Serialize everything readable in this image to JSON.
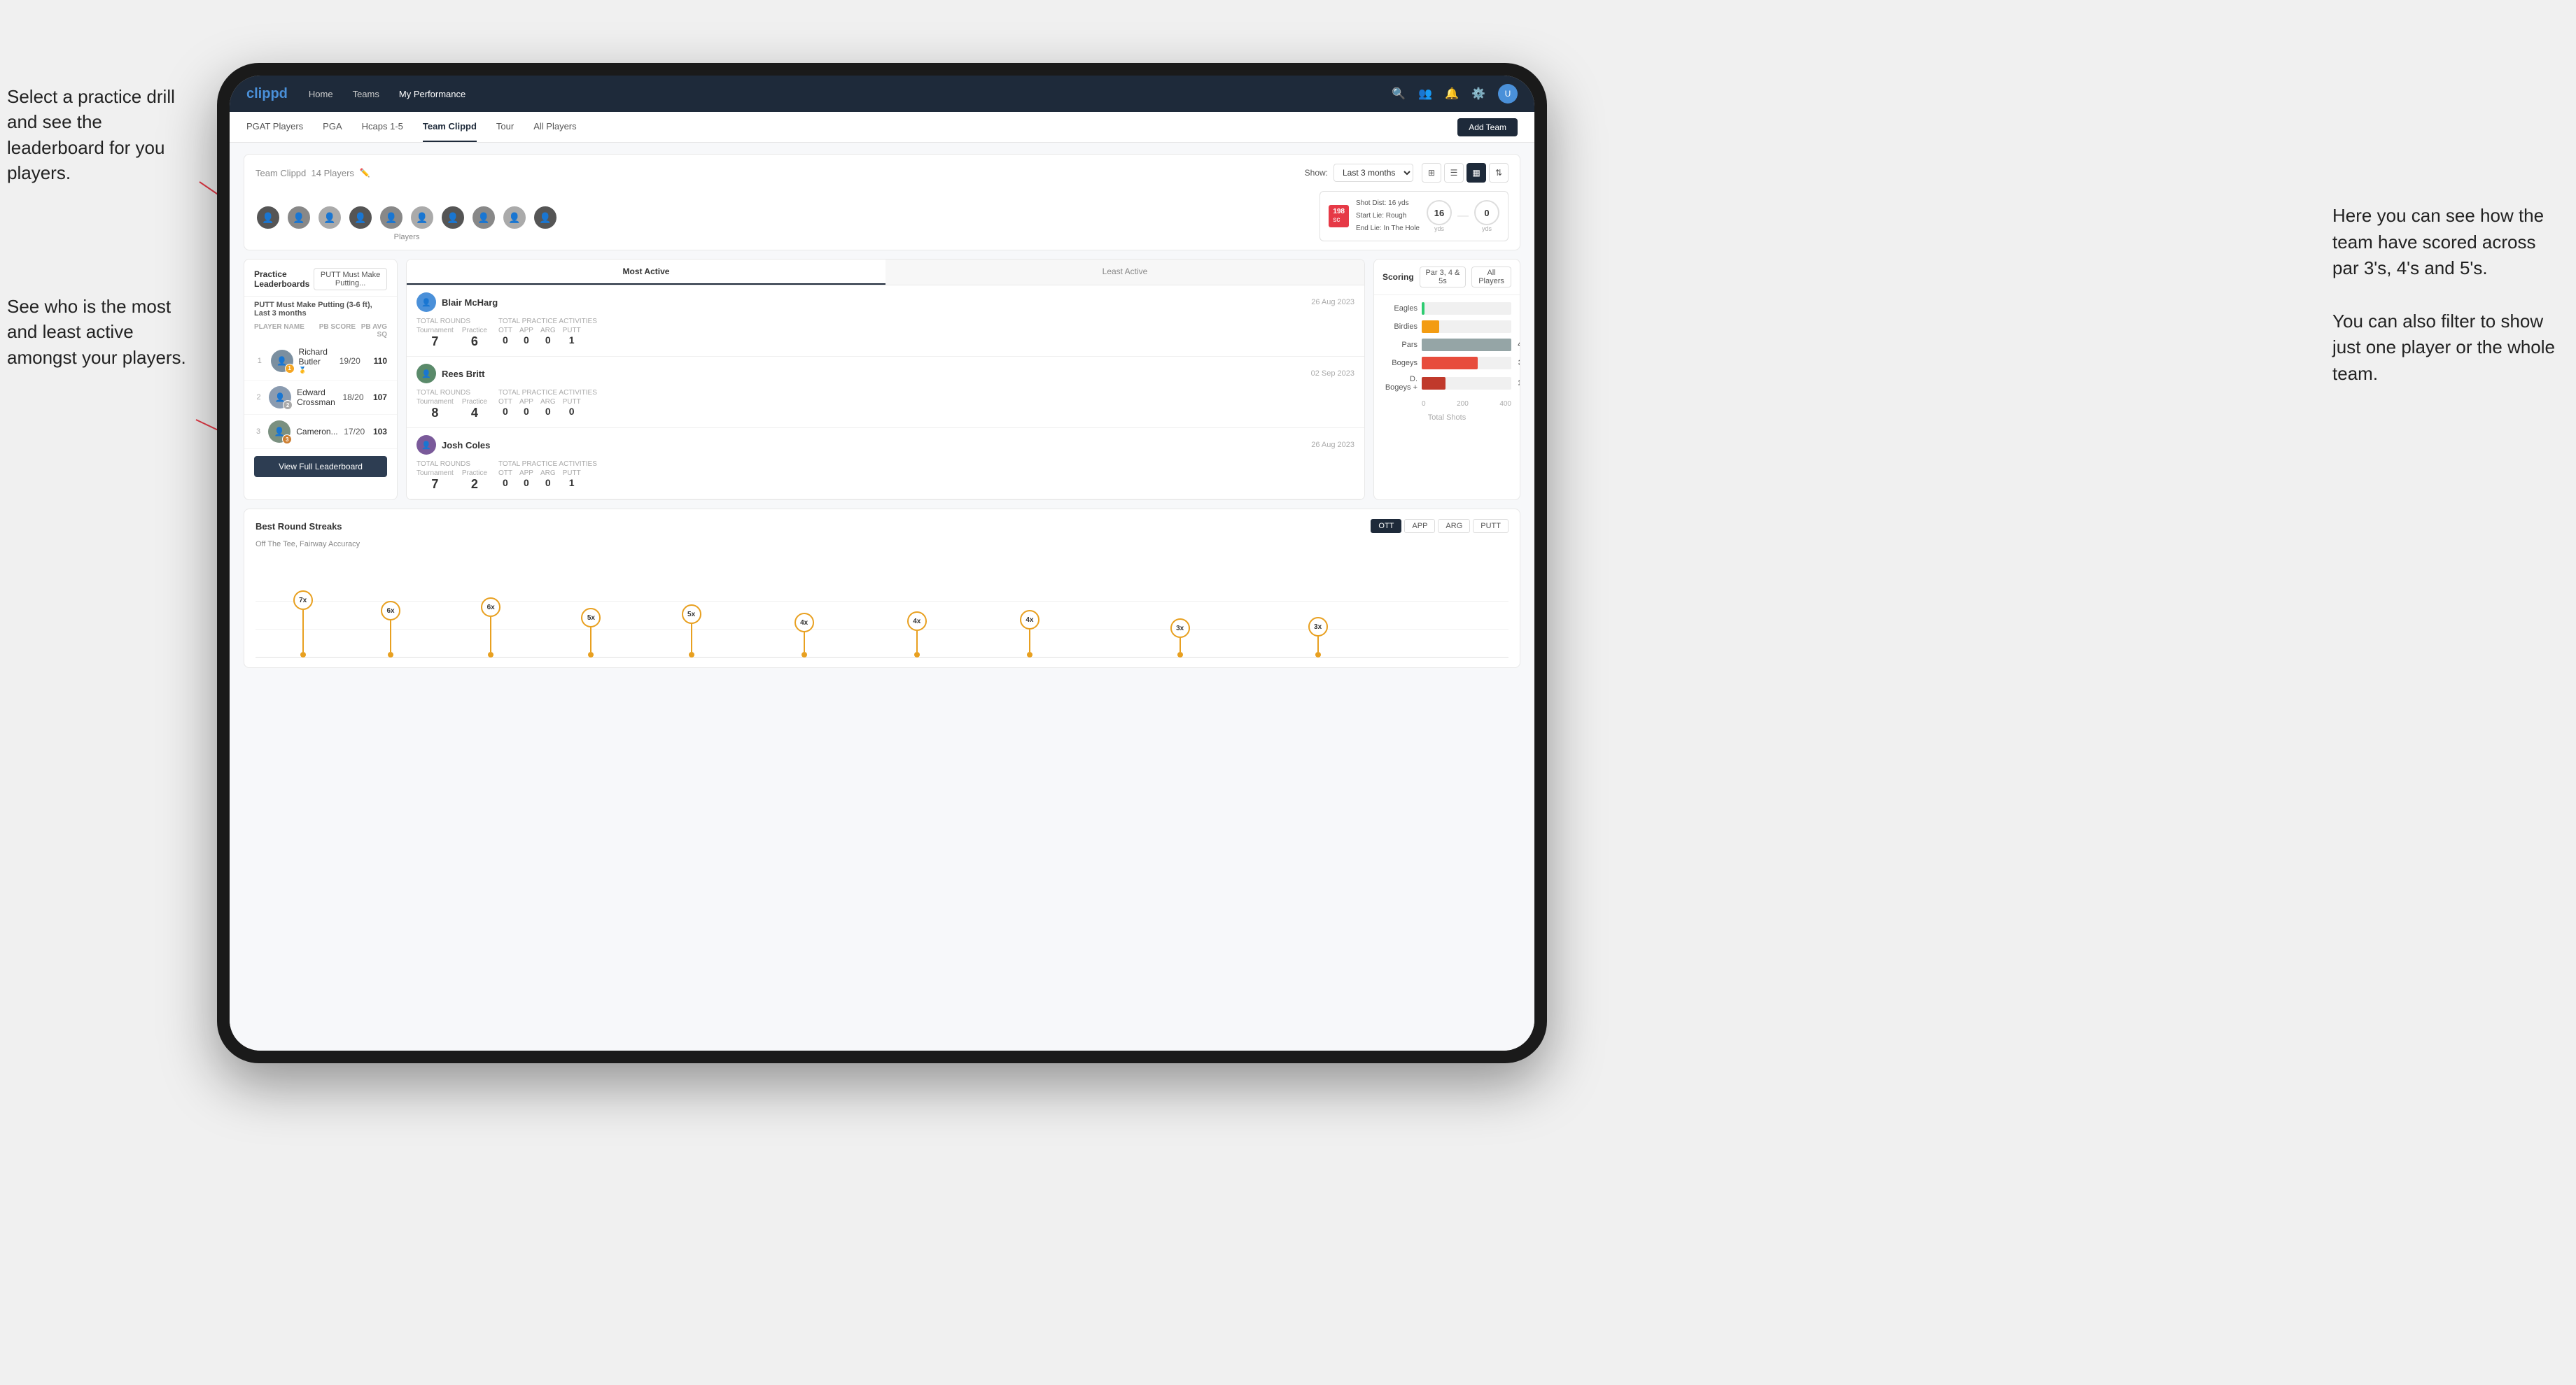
{
  "annotations": {
    "left1": "Select a practice drill and see the leaderboard for you players.",
    "left2": "See who is the most and least active amongst your players.",
    "right1_line1": "Here you can see how the",
    "right1_line2": "team have scored across",
    "right1_line3": "par 3's, 4's and 5's.",
    "right1_line4": "",
    "right1_line5": "You can also filter to show",
    "right1_line6": "just one player or the whole",
    "right1_line7": "team."
  },
  "navbar": {
    "logo": "clippd",
    "links": [
      "Home",
      "Teams",
      "My Performance"
    ],
    "icons": [
      "search",
      "people",
      "bell",
      "settings",
      "avatar"
    ]
  },
  "subnav": {
    "links": [
      "PGAT Players",
      "PGA",
      "Hcaps 1-5",
      "Team Clippd",
      "Tour",
      "All Players"
    ],
    "active": "Team Clippd",
    "add_button": "Add Team"
  },
  "team_header": {
    "title": "Team Clippd",
    "player_count": "14 Players",
    "show_label": "Show:",
    "period": "Last 3 months",
    "players_label": "Players"
  },
  "shot_info": {
    "shot_dist": "Shot Dist: 16 yds",
    "start_lie": "Start Lie: Rough",
    "end_lie": "End Lie: In The Hole",
    "value1": "198",
    "unit1": "sc",
    "yards1": "16",
    "unit_yds1": "yds",
    "yards2": "0",
    "unit_yds2": "yds"
  },
  "practice_leaderboards": {
    "title": "Practice Leaderboards",
    "dropdown": "PUTT Must Make Putting...",
    "subtitle_drill": "PUTT Must Make Putting (3-6 ft),",
    "subtitle_period": "Last 3 months",
    "col_player": "PLAYER NAME",
    "col_score": "PB SCORE",
    "col_avg": "PB AVG SQ",
    "players": [
      {
        "rank": 1,
        "name": "Richard Butler",
        "score": "19/20",
        "avg": "110",
        "badge": "gold",
        "avatar_color": "#7b8fa0"
      },
      {
        "rank": 2,
        "name": "Edward Crossman",
        "score": "18/20",
        "avg": "107",
        "badge": "silver",
        "avatar_color": "#8a9bb0"
      },
      {
        "rank": 3,
        "name": "Cameron...",
        "score": "17/20",
        "avg": "103",
        "badge": "bronze",
        "avatar_color": "#7a9080"
      }
    ],
    "view_full_btn": "View Full Leaderboard"
  },
  "activity_panel": {
    "tabs": [
      "Most Active",
      "Least Active"
    ],
    "active_tab": "Most Active",
    "players": [
      {
        "name": "Blair McHarg",
        "date": "26 Aug 2023",
        "total_rounds_label": "Total Rounds",
        "tournament": "7",
        "practice": "6",
        "total_practice_label": "Total Practice Activities",
        "ott": "0",
        "app": "0",
        "arg": "0",
        "putt": "1"
      },
      {
        "name": "Rees Britt",
        "date": "02 Sep 2023",
        "total_rounds_label": "Total Rounds",
        "tournament": "8",
        "practice": "4",
        "total_practice_label": "Total Practice Activities",
        "ott": "0",
        "app": "0",
        "arg": "0",
        "putt": "0"
      },
      {
        "name": "Josh Coles",
        "date": "26 Aug 2023",
        "total_rounds_label": "Total Rounds",
        "tournament": "7",
        "practice": "2",
        "total_practice_label": "Total Practice Activities",
        "ott": "0",
        "app": "0",
        "arg": "0",
        "putt": "1"
      }
    ]
  },
  "scoring_panel": {
    "title": "Scoring",
    "filter": "Par 3, 4 & 5s",
    "player_filter": "All Players",
    "bars": [
      {
        "label": "Eagles",
        "value": 3,
        "max": 500,
        "type": "eagles",
        "color": "#2ecc71"
      },
      {
        "label": "Birdies",
        "value": 96,
        "max": 500,
        "type": "birdies",
        "color": "#f39c12"
      },
      {
        "label": "Pars",
        "value": 499,
        "max": 500,
        "type": "pars",
        "color": "#95a5a6"
      },
      {
        "label": "Bogeys",
        "value": 311,
        "max": 500,
        "type": "bogeys",
        "color": "#e74c3c"
      },
      {
        "label": "D. Bogeys +",
        "value": 131,
        "max": 500,
        "type": "dbogeys",
        "color": "#c0392b"
      }
    ],
    "x_labels": [
      "0",
      "200",
      "400"
    ],
    "footer": "Total Shots"
  },
  "streaks": {
    "title": "Best Round Streaks",
    "subtitle": "Off The Tee, Fairway Accuracy",
    "filters": [
      "OTT",
      "APP",
      "ARG",
      "PUTT"
    ],
    "active_filter": "OTT",
    "nodes": [
      {
        "x": 5,
        "label": "7x"
      },
      {
        "x": 8,
        "label": "6x"
      },
      {
        "x": 12,
        "label": "6x"
      },
      {
        "x": 17,
        "label": "5x"
      },
      {
        "x": 21,
        "label": "5x"
      },
      {
        "x": 26,
        "label": "4x"
      },
      {
        "x": 30,
        "label": "4x"
      },
      {
        "x": 34,
        "label": "4x"
      },
      {
        "x": 38,
        "label": "3x"
      },
      {
        "x": 42,
        "label": "3x"
      }
    ]
  }
}
